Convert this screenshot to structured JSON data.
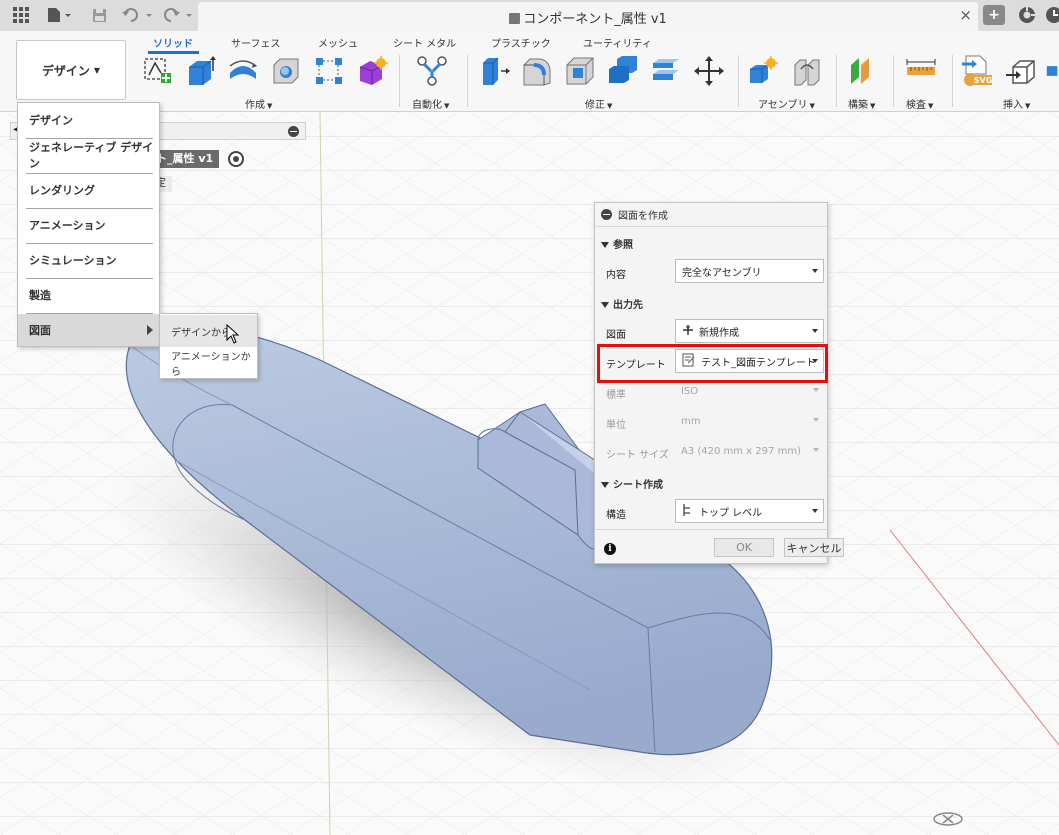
{
  "titlebar": {
    "document_title": "コンポーネント_属性 v1",
    "close_symbol": "×",
    "new_tab_symbol": "+"
  },
  "ribbon": {
    "workspace_button": "デザイン",
    "tabs": [
      "ソリッド",
      "サーフェス",
      "メッシュ",
      "シート メタル",
      "プラスチック",
      "ユーティリティ"
    ],
    "groups": {
      "create": "作成",
      "automate": "自動化",
      "modify": "修正",
      "assemble": "アセンブリ",
      "construct": "構築",
      "inspect": "検査",
      "insert": "挿入"
    },
    "svg_badge": "SVG"
  },
  "browser": {
    "node_label": "ト_属性 v1",
    "sub_label": "定"
  },
  "workspace_menu": {
    "items": [
      "デザイン",
      "ジェネレーティブ デザイン",
      "レンダリング",
      "アニメーション",
      "シミュレーション",
      "製造",
      "図面"
    ],
    "submenu": [
      "デザインから",
      "アニメーションから"
    ]
  },
  "dialog": {
    "title": "図面を作成",
    "section_reference": "参照",
    "label_contents": "内容",
    "value_contents": "完全なアセンブリ",
    "section_output": "出力先",
    "label_drawing": "図面",
    "value_drawing": "新規作成",
    "label_template": "テンプレート",
    "value_template": "テスト_図面テンプレート",
    "label_standard": "標準",
    "value_standard": "ISO",
    "label_units": "単位",
    "value_units": "mm",
    "label_sheet_size": "シート サイズ",
    "value_sheet_size": "A3 (420 mm x 297 mm)",
    "section_sheet": "シート作成",
    "label_structure": "構造",
    "value_structure": "トップ レベル",
    "info_symbol": "i",
    "ok_label": "OK",
    "cancel_label": "キャンセル"
  },
  "colors": {
    "accent": "#1f6fc5",
    "highlight_box": "#e01010",
    "model_body": "#a8b8d4",
    "menu_highlight": "#d9d9d9"
  }
}
